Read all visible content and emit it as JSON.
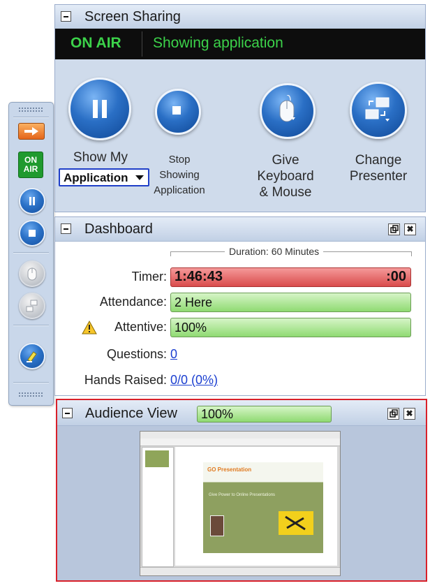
{
  "screen_sharing": {
    "title": "Screen Sharing",
    "on_air": "ON AIR",
    "status": "Showing application",
    "actions": {
      "show_label": "Show My",
      "show_select_value": "Application",
      "stop_line1": "Stop",
      "stop_line2": "Showing",
      "stop_line3": "Application",
      "give_line1": "Give",
      "give_line2": "Keyboard",
      "give_line3": "& Mouse",
      "change_line1": "Change",
      "change_line2": "Presenter"
    }
  },
  "toolbar": {
    "on_air_line1": "ON",
    "on_air_line2": "AIR"
  },
  "dashboard": {
    "title": "Dashboard",
    "duration": "Duration: 60 Minutes",
    "timer_label": "Timer:",
    "timer_value": "1:46:43",
    "timer_suffix": ":00",
    "attendance_label": "Attendance:",
    "attendance_value": "2 Here",
    "attentive_label": "Attentive:",
    "attentive_value": "100%",
    "questions_label": "Questions:",
    "questions_value": "0",
    "hands_label": "Hands Raised:",
    "hands_value": "0/0 (0%)"
  },
  "audience_view": {
    "title": "Audience View",
    "value": "100%",
    "preview": {
      "slide_title": "GO Presentation",
      "slide_text": "Give Power to Online Presentations"
    }
  },
  "colors": {
    "on_air_green": "#3cd24a",
    "highlight_red": "#d9202a",
    "timer_red": "#d94b4b",
    "meter_green": "#8fda72"
  },
  "icons": [
    "pause-icon",
    "stop-icon",
    "mouse-icon",
    "change-presenter-icon",
    "arrow-icon",
    "highlighter-icon",
    "restore-icon",
    "close-icon",
    "warning-icon"
  ]
}
